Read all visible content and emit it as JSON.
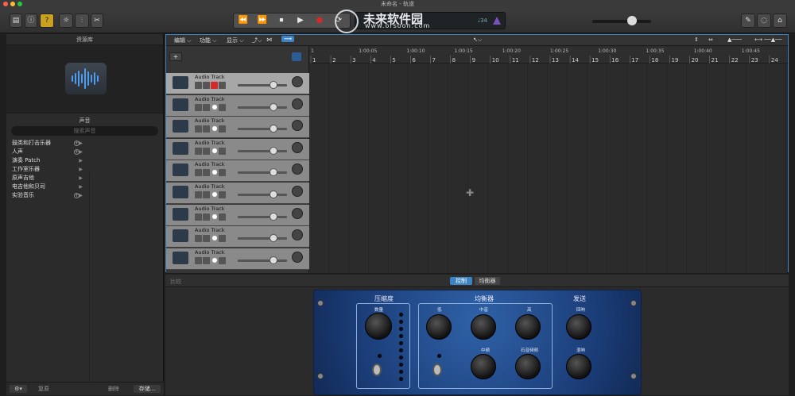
{
  "window": {
    "title": "未命名 - 轨道"
  },
  "toolbar": {
    "bpm": "♩34",
    "transport": [
      "⏪",
      "⏩",
      "⏹",
      "▶",
      "●",
      "⟳"
    ],
    "left_icons": [
      "library-icon",
      "info-icon",
      "help-icon",
      "settings-icon",
      "mixer-icon",
      "scissors-icon"
    ],
    "right_icons": [
      "notepad-icon",
      "loop-icon",
      "browser-icon"
    ],
    "master_volume": 0.6
  },
  "watermark": {
    "title": "未来软件园",
    "url": "www.orsoon.com"
  },
  "library": {
    "header": "资源库",
    "section": "声音",
    "search_placeholder": "搜索声音",
    "categories": [
      {
        "label": "鼓类和打击乐器",
        "has_add": true
      },
      {
        "label": "人声",
        "has_add": true
      },
      {
        "label": "演奏 Patch",
        "has_add": false
      },
      {
        "label": "工作室乐器",
        "has_add": false
      },
      {
        "label": "原声吉他",
        "has_add": false
      },
      {
        "label": "电吉他和贝司",
        "has_add": false
      },
      {
        "label": "实验音乐",
        "has_add": true
      }
    ],
    "bottom": {
      "revert": "复原",
      "delete": "删除",
      "save": "存储..."
    }
  },
  "tracks_toolbar": {
    "edit": "编辑",
    "functions": "功能",
    "view": "显示"
  },
  "ruler": {
    "bars": [
      "1",
      "2",
      "3",
      "4",
      "5",
      "6",
      "7",
      "8",
      "9",
      "10",
      "11",
      "12",
      "13",
      "14",
      "15",
      "16",
      "17",
      "18",
      "19",
      "20",
      "21",
      "22",
      "23",
      "24"
    ],
    "times": [
      "1",
      "1:00:05",
      "1:00:10",
      "1:00:15",
      "1:00:20",
      "1:00:25",
      "1:00:30",
      "1:00:35",
      "1:00:40",
      "1:00:45"
    ]
  },
  "tracks": [
    {
      "name": "Audio Track",
      "rec": true,
      "selected": true
    },
    {
      "name": "Audio Track",
      "rec": false,
      "selected": false
    },
    {
      "name": "Audio Track",
      "rec": false,
      "selected": false
    },
    {
      "name": "Audio Track",
      "rec": false,
      "selected": false
    },
    {
      "name": "Audio Track",
      "rec": false,
      "selected": false
    },
    {
      "name": "Audio Track",
      "rec": false,
      "selected": false
    },
    {
      "name": "Audio Track",
      "rec": false,
      "selected": false
    },
    {
      "name": "Audio Track",
      "rec": false,
      "selected": false
    },
    {
      "name": "Audio Track",
      "rec": false,
      "selected": false
    }
  ],
  "smart_controls": {
    "compare": "比较",
    "tabs": [
      "控制",
      "均衡器"
    ],
    "active_tab": 0,
    "sections": {
      "compressor": "压缩度",
      "eq": "均衡器",
      "sends": "发送"
    },
    "knob_labels": {
      "amount": "数量",
      "low": "低",
      "mid": "中音",
      "high": "高",
      "mid_freq": "中频",
      "treble_freq": "石音频频",
      "reverb": "混响",
      "echo": "回响"
    }
  },
  "colors": {
    "accent": "#3d84c6",
    "panel": "#1a3b75",
    "record": "#d22b2b"
  }
}
